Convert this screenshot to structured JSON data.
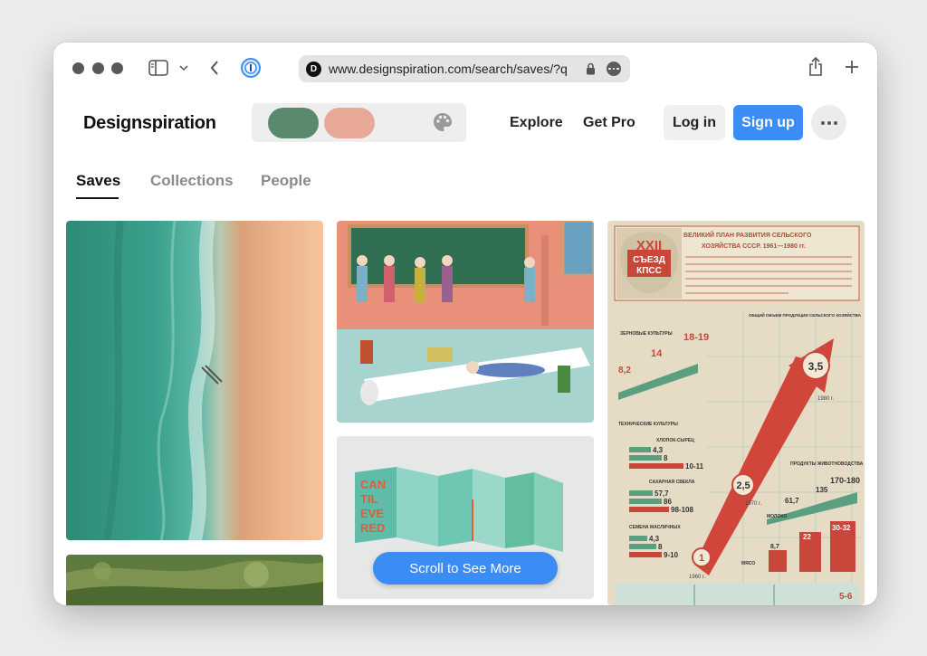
{
  "browser": {
    "url": "www.designspiration.com/search/saves/?q",
    "favicon_letter": "D"
  },
  "header": {
    "logo": "Designspiration",
    "color_swatches": [
      "#5a8a6e",
      "#e8a898"
    ],
    "nav": [
      "Explore",
      "Get Pro"
    ],
    "login_label": "Log in",
    "signup_label": "Sign up"
  },
  "tabs": [
    {
      "label": "Saves",
      "active": true
    },
    {
      "label": "Collections",
      "active": false
    },
    {
      "label": "People",
      "active": false
    }
  ],
  "grid": {
    "scroll_label": "Scroll to See More",
    "folder_lines": [
      "CAN",
      "TIL",
      "EVE",
      "RED"
    ],
    "poster": {
      "title_line1": "ВЕЛИКИЙ ПЛАН РАЗВИТИЯ СЕЛЬСКОГО",
      "title_line2": "ХОЗЯЙСТВА СССР. 1961—1980 гг.",
      "badge_line1": "XXII",
      "badge_line2": "СЪЕЗД",
      "badge_line3": "КПСС",
      "labels": {
        "grain": "ЗЕРНОВЫЕ КУЛЬТУРЫ",
        "total": "ОБЩИЙ ОБЪЕМ ПРОДУКЦИИ СЕЛЬСКОГО ХОЗЯЙСТВА",
        "tech": "ТЕХНИЧЕСКИЕ КУЛЬТУРЫ",
        "cotton": "ХЛОПОК-СЫРЕЦ",
        "sugar": "САХАРНАЯ СВЕКЛА",
        "oilseed": "СЕМЕНА МАСЛИЧНЫХ",
        "livestock": "ПРОДУКТЫ ЖИВОТНОВОДСТВА",
        "milk": "МОЛОКО",
        "meat": "МЯСО"
      },
      "numbers": {
        "n1": "8,2",
        "n2": "14",
        "n3": "18-19",
        "n4": "3,5",
        "n5": "2,5",
        "n6": "1",
        "n7": "4,3",
        "n8": "8",
        "n9": "10-11",
        "n10": "57,7",
        "n11": "86",
        "n12": "98-108",
        "n13": "4,3",
        "n14": "8",
        "n15": "9-10",
        "n16": "61,7",
        "n17": "135",
        "n18": "170-180",
        "n19": "8,7",
        "n20": "22",
        "n21": "30-32",
        "n22": "5-6"
      },
      "years": {
        "y1960": "1960 г.",
        "y1970": "1970 г.",
        "y1980": "1980 г."
      }
    }
  }
}
